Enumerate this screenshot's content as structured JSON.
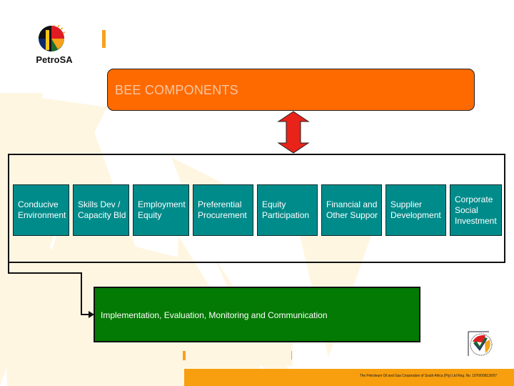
{
  "company": {
    "name": "PetroSA"
  },
  "header": {
    "title": "BEE COMPONENTS"
  },
  "components": [
    {
      "line1": "Conducive",
      "line2": "Environment",
      "line3": ""
    },
    {
      "line1": "Skills Dev /",
      "line2": "Capacity Bld",
      "line3": ""
    },
    {
      "line1": "Employment",
      "line2": "Equity",
      "line3": ""
    },
    {
      "line1": "Preferential",
      "line2": "Procurement",
      "line3": ""
    },
    {
      "line1": "Equity",
      "line2": "Participation",
      "line3": ""
    },
    {
      "line1": "Financial and",
      "line2": "Other Suppor",
      "line3": ""
    },
    {
      "line1": "Supplier",
      "line2": "Development",
      "line3": ""
    },
    {
      "line1": "Corporate",
      "line2": "Social",
      "line3": "Investment"
    }
  ],
  "implementation": {
    "label": "Implementation, Evaluation, Monitoring and Communication"
  },
  "footer": {
    "text": "The Petroleum Oil and Gas Corporation of South Africa (Pty) Ltd  Reg. No. 1970/008130/07"
  },
  "icons": {
    "logo": "petrosa-logo-icon",
    "arrow": "double-arrow-icon",
    "badge": "bee-certification-badge-icon"
  },
  "colors": {
    "header_box": "#ff6a00",
    "tiles": "#008b8b",
    "implementation_box": "#037a03",
    "arrow": "#e8231a",
    "accent": "#f79f0e",
    "background_wedges": "#fff6e2"
  }
}
